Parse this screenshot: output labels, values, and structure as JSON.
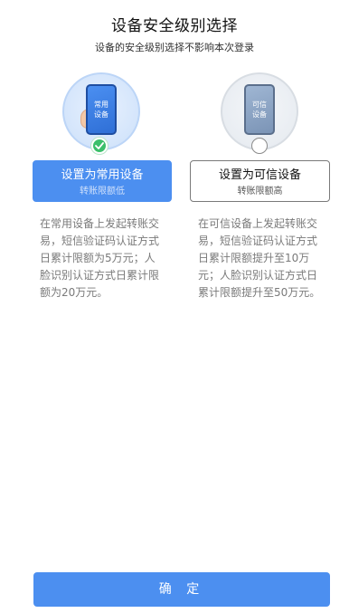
{
  "header": {
    "title": "设备安全级别选择",
    "subtitle": "设备的安全级别选择不影响本次登录"
  },
  "options": [
    {
      "illustration_text": "常用\n设备",
      "label": "设置为常用设备",
      "sub": "转账限额低",
      "description": "在常用设备上发起转账交易，短信验证码认证方式日累计限额为5万元；人脸识别认证方式日累计限额为20万元。",
      "selected": true
    },
    {
      "illustration_text": "可信\n设备",
      "label": "设置为可信设备",
      "sub": "转账限额高",
      "description": "在可信设备上发起转账交易，短信验证码认证方式日累计限额提升至10万元；人脸识别认证方式日累计限额提升至50万元。",
      "selected": false
    }
  ],
  "footer": {
    "confirm_label": "确 定"
  },
  "colors": {
    "primary": "#4c8ff0",
    "check_green": "#3bbf6a",
    "text_gray": "#7a7a7a"
  },
  "icons": {
    "left_illustration": "phone-in-hand-icon",
    "right_illustration": "phone-icon",
    "selected_indicator": "check-circle-icon",
    "unselected_indicator": "radio-empty-icon"
  }
}
